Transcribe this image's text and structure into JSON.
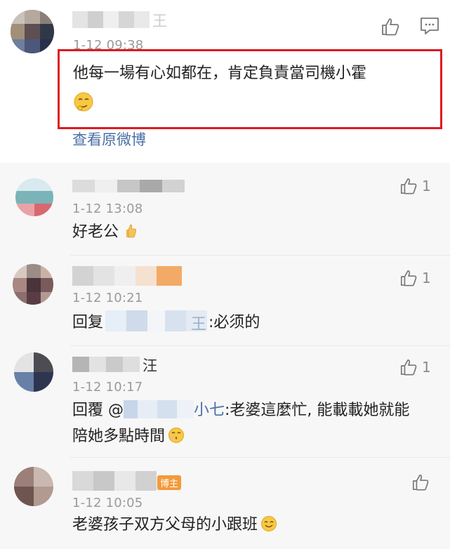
{
  "main_comment": {
    "name_blurred": "王",
    "timestamp": "1-12 09:38",
    "text": "他每一場有心如都在，肯定負責當司機小霍",
    "emoji": "smirk-emoji",
    "view_original": "查看原微博"
  },
  "replies": [
    {
      "name_blurred": "",
      "timestamp": "1-12 13:08",
      "text": "好老公",
      "emoji": "thumbs-up-emoji",
      "likes": "1"
    },
    {
      "name_blurred": "",
      "timestamp": "1-12 10:21",
      "prefix": "回复",
      "mention": "王",
      "text": ":必须的",
      "likes": "1"
    },
    {
      "name_blurred": "汪",
      "timestamp": "1-12 10:17",
      "prefix": "回覆 @",
      "mention": "小七",
      "text": ":老婆這麼忙, 能載載她就能",
      "text2": "陪她多點時間",
      "emoji": "kiss-emoji",
      "likes": "1"
    },
    {
      "name_blurred": "",
      "badge": "博主",
      "timestamp": "1-12 10:05",
      "text": "老婆孩子双方父母的小跟班",
      "emoji": "smile-emoji",
      "likes": ""
    }
  ],
  "colors": {
    "highlight": "#e0191f",
    "link": "#4a6fa5",
    "badge": "#f39a3a",
    "reply_bg": "#f7f7f7"
  }
}
